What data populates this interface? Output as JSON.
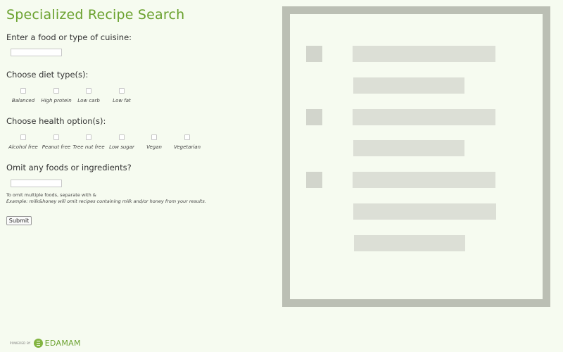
{
  "title": "Specialized Recipe Search",
  "food_question": "Enter a food or type of cuisine:",
  "food_input": {
    "value": "",
    "placeholder": ""
  },
  "diet_question": "Choose diet type(s):",
  "diet_options": [
    {
      "label": "Balanced",
      "checked": false
    },
    {
      "label": "High protein",
      "checked": false
    },
    {
      "label": "Low carb",
      "checked": false
    },
    {
      "label": "Low fat",
      "checked": false
    }
  ],
  "health_question": "Choose health option(s):",
  "health_options": [
    {
      "label": "Alcohol free",
      "checked": false
    },
    {
      "label": "Peanut free",
      "checked": false
    },
    {
      "label": "Tree nut free",
      "checked": false
    },
    {
      "label": "Low sugar",
      "checked": false
    },
    {
      "label": "Vegan",
      "checked": false
    },
    {
      "label": "Vegetarian",
      "checked": false
    }
  ],
  "omit_question": "Omit any foods or ingredients?",
  "omit_input": {
    "value": "",
    "placeholder": ""
  },
  "omit_help": "To omit multiple foods, separate with &",
  "omit_example": "Example: milk&honey will omit recipes containing milk and/or honey from your results.",
  "submit_label": "Submit",
  "footer": {
    "powered_by": "POWERED BY",
    "brand": "EDAMAM"
  },
  "colors": {
    "accent": "#6aa12e",
    "background": "#f6fbf0",
    "panel_frame": "#bbbfb4",
    "placeholder_bar": "#dcdfd6"
  }
}
